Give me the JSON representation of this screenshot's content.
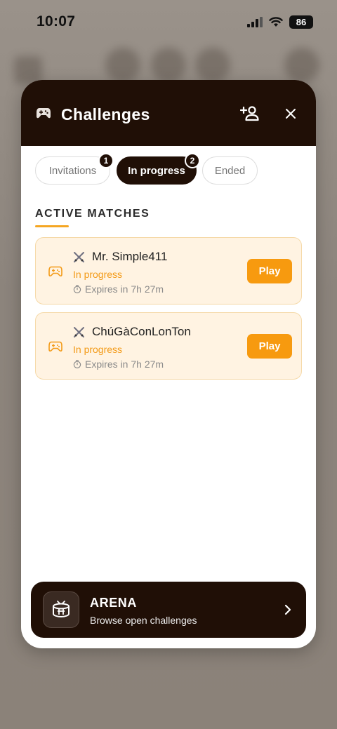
{
  "status_bar": {
    "time": "10:07",
    "battery": "86"
  },
  "modal": {
    "title": "Challenges",
    "header_icon": "gamepad-icon",
    "add_icon": "add-friend-icon",
    "close_icon": "close-icon"
  },
  "tabs": [
    {
      "label": "Invitations",
      "badge": "1",
      "active": false
    },
    {
      "label": "In progress",
      "badge": "2",
      "active": true
    },
    {
      "label": "Ended",
      "badge": "",
      "active": false
    }
  ],
  "section": {
    "title": "ACTIVE MATCHES"
  },
  "matches": [
    {
      "opponent": "Mr. Simple411",
      "status": "In progress",
      "expires": "Expires in 7h 27m",
      "action": "Play"
    },
    {
      "opponent": "ChúGàConLonTon",
      "status": "In progress",
      "expires": "Expires in 7h 27m",
      "action": "Play"
    }
  ],
  "arena": {
    "title": "ARENA",
    "subtitle": "Browse open challenges",
    "icon": "arena-icon"
  },
  "colors": {
    "dark": "#200f06",
    "accent": "#f79a0f",
    "card_bg": "#fff3e2"
  }
}
